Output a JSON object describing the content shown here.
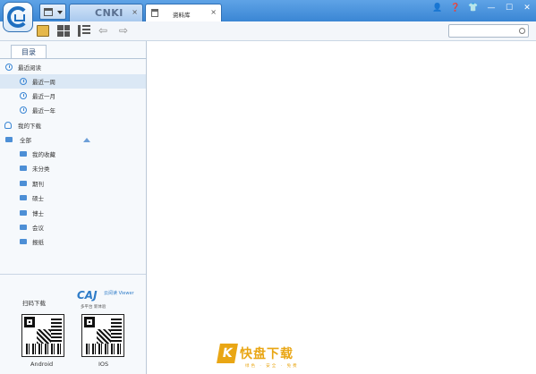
{
  "tabs": [
    {
      "label": "CNKI",
      "close": "×"
    },
    {
      "label": "资料库",
      "close": "×"
    }
  ],
  "window_controls": [
    "👤",
    "❓",
    "👕",
    "—",
    "☐",
    "✕"
  ],
  "sidebar": {
    "tab": "目录",
    "items": [
      {
        "label": "最近阅读",
        "icon": "clock-icon"
      },
      {
        "label": "最近一周",
        "icon": "clock-icon"
      },
      {
        "label": "最近一月",
        "icon": "clock-icon"
      },
      {
        "label": "最近一年",
        "icon": "clock-icon"
      },
      {
        "label": "我的下载",
        "icon": "download-icon"
      },
      {
        "label": "全部",
        "icon": "folder-icon"
      },
      {
        "label": "我的收藏",
        "icon": "folder-icon"
      },
      {
        "label": "未分类",
        "icon": "folder-icon"
      },
      {
        "label": "期刊",
        "icon": "folder-icon"
      },
      {
        "label": "硕士",
        "icon": "folder-icon"
      },
      {
        "label": "博士",
        "icon": "folder-icon"
      },
      {
        "label": "会议",
        "icon": "folder-icon"
      },
      {
        "label": "报纸",
        "icon": "folder-icon"
      }
    ]
  },
  "qr": {
    "scan_label": "扫码下载",
    "brand": "CAJ",
    "brand_sub": "云阅读 Viewer",
    "tagline": "多平台 新体验",
    "android": "Android",
    "ios": "IOS"
  },
  "watermark": {
    "mark": "K",
    "text": "快盘下载",
    "sub": "绿色 · 安全 · 免费"
  }
}
